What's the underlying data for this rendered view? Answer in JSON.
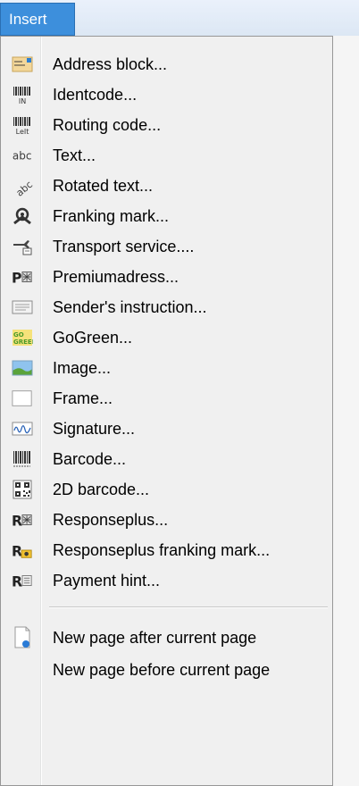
{
  "menu": {
    "title": "Insert"
  },
  "items": [
    {
      "label": "Address block...",
      "icon": "address-block-icon"
    },
    {
      "label": "Identcode...",
      "icon": "identcode-icon"
    },
    {
      "label": "Routing code...",
      "icon": "routing-code-icon"
    },
    {
      "label": "Text...",
      "icon": "text-icon",
      "icon_text": "abc"
    },
    {
      "label": "Rotated text...",
      "icon": "rotated-text-icon",
      "icon_text": "abc"
    },
    {
      "label": "Franking mark...",
      "icon": "franking-mark-icon"
    },
    {
      "label": "Transport service....",
      "icon": "transport-service-icon"
    },
    {
      "label": "Premiumadress...",
      "icon": "premiumadress-icon",
      "icon_text": "P"
    },
    {
      "label": "Sender's instruction...",
      "icon": "senders-instruction-icon"
    },
    {
      "label": "GoGreen...",
      "icon": "gogreen-icon",
      "icon_text": "GO GREEN"
    },
    {
      "label": "Image...",
      "icon": "image-icon"
    },
    {
      "label": "Frame...",
      "icon": "frame-icon"
    },
    {
      "label": "Signature...",
      "icon": "signature-icon"
    },
    {
      "label": "Barcode...",
      "icon": "barcode-icon"
    },
    {
      "label": "2D barcode...",
      "icon": "2d-barcode-icon"
    },
    {
      "label": "Responseplus...",
      "icon": "responseplus-icon",
      "icon_text": "R"
    },
    {
      "label": "Responseplus franking mark...",
      "icon": "responseplus-franking-mark-icon",
      "icon_text": "R"
    },
    {
      "label": "Payment hint...",
      "icon": "payment-hint-icon",
      "icon_text": "R"
    },
    {
      "label": "New page after current page",
      "icon": "new-page-icon"
    },
    {
      "label": "New page before current page",
      "icon": ""
    }
  ],
  "colors": {
    "highlight": "#3d8fdc",
    "menu_bg": "#f0f0f0",
    "text": "#000000"
  }
}
